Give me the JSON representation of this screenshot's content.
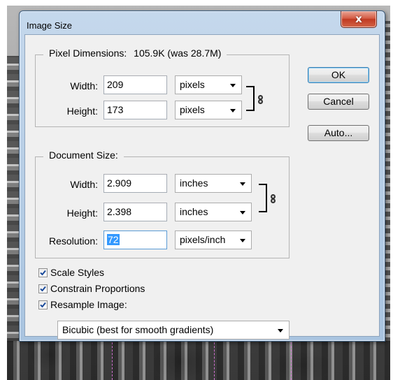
{
  "window": {
    "title": "Image Size",
    "close_glyph": "x"
  },
  "pixel_dimensions": {
    "legend": "Pixel Dimensions:",
    "size_info": "105.9K (was 28.7M)",
    "width_label": "Width:",
    "width_value": "209",
    "width_unit": "pixels",
    "height_label": "Height:",
    "height_value": "173",
    "height_unit": "pixels"
  },
  "document_size": {
    "legend": "Document Size:",
    "width_label": "Width:",
    "width_value": "2.909",
    "width_unit": "inches",
    "height_label": "Height:",
    "height_value": "2.398",
    "height_unit": "inches",
    "resolution_label": "Resolution:",
    "resolution_value": "72",
    "resolution_unit": "pixels/inch"
  },
  "buttons": {
    "ok": "OK",
    "cancel": "Cancel",
    "auto": "Auto..."
  },
  "options": {
    "scale_styles": {
      "label": "Scale Styles",
      "checked": true
    },
    "constrain_proportions": {
      "label": "Constrain Proportions",
      "checked": true
    },
    "resample_image": {
      "label": "Resample Image:",
      "checked": true
    }
  },
  "resample_method": "Bicubic (best for smooth gradients)",
  "icons": {
    "link": "chain-link-icon",
    "dropdown": "chevron-down-icon",
    "check": "checkmark-icon",
    "close": "close-icon"
  },
  "colors": {
    "title_bar": "#b9d1ea",
    "close_button": "#c8412a",
    "selection": "#3399ff",
    "dialog_bg": "#f0f0f0"
  }
}
